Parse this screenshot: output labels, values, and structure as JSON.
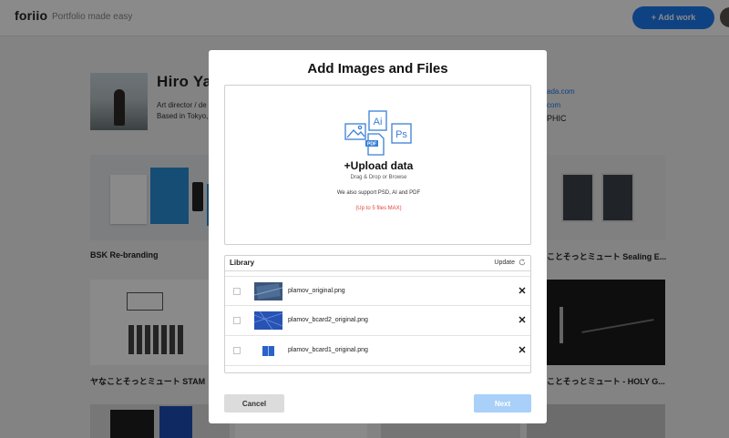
{
  "header": {
    "logo": "foriio",
    "tagline": "Portfolio made easy",
    "add_work_label": "+ Add work"
  },
  "profile": {
    "name": "Hiro Yam",
    "role": "Art director / de",
    "location": "Based in Tokyo,",
    "link_1": "ada.com",
    "link_2": "com",
    "extra": "PHIC"
  },
  "works": [
    {
      "title": "BSK Re-branding"
    },
    {
      "title": "ことそっとミュート Sealing E..."
    },
    {
      "title": "ヤなことそっとミュート STAM"
    },
    {
      "title": "ことそっとミュート - HOLY G..."
    }
  ],
  "modal": {
    "title": "Add Images and Files",
    "upload": {
      "title": "+Upload data",
      "hint": "Drag & Drop or Browse",
      "support": "We also support PSD, AI and PDF",
      "limit": "(Up to 5 files MAX)"
    },
    "library": {
      "title": "Library",
      "update_label": "Update",
      "files": [
        {
          "name": "plamov_original.png"
        },
        {
          "name": "plamov_bcard2_original.png"
        },
        {
          "name": "plamov_bcard1_original.png"
        }
      ]
    },
    "cancel_label": "Cancel",
    "next_label": "Next"
  },
  "colors": {
    "accent": "#1a7bf2",
    "next_disabled": "#a8d0f8",
    "limit_text": "#e0463a",
    "overlay": "rgba(0,0,0,0.46)"
  },
  "icons": [
    "image-icon",
    "ai-file-icon",
    "pdf-file-icon",
    "ps-file-icon",
    "refresh-icon",
    "close-icon"
  ]
}
